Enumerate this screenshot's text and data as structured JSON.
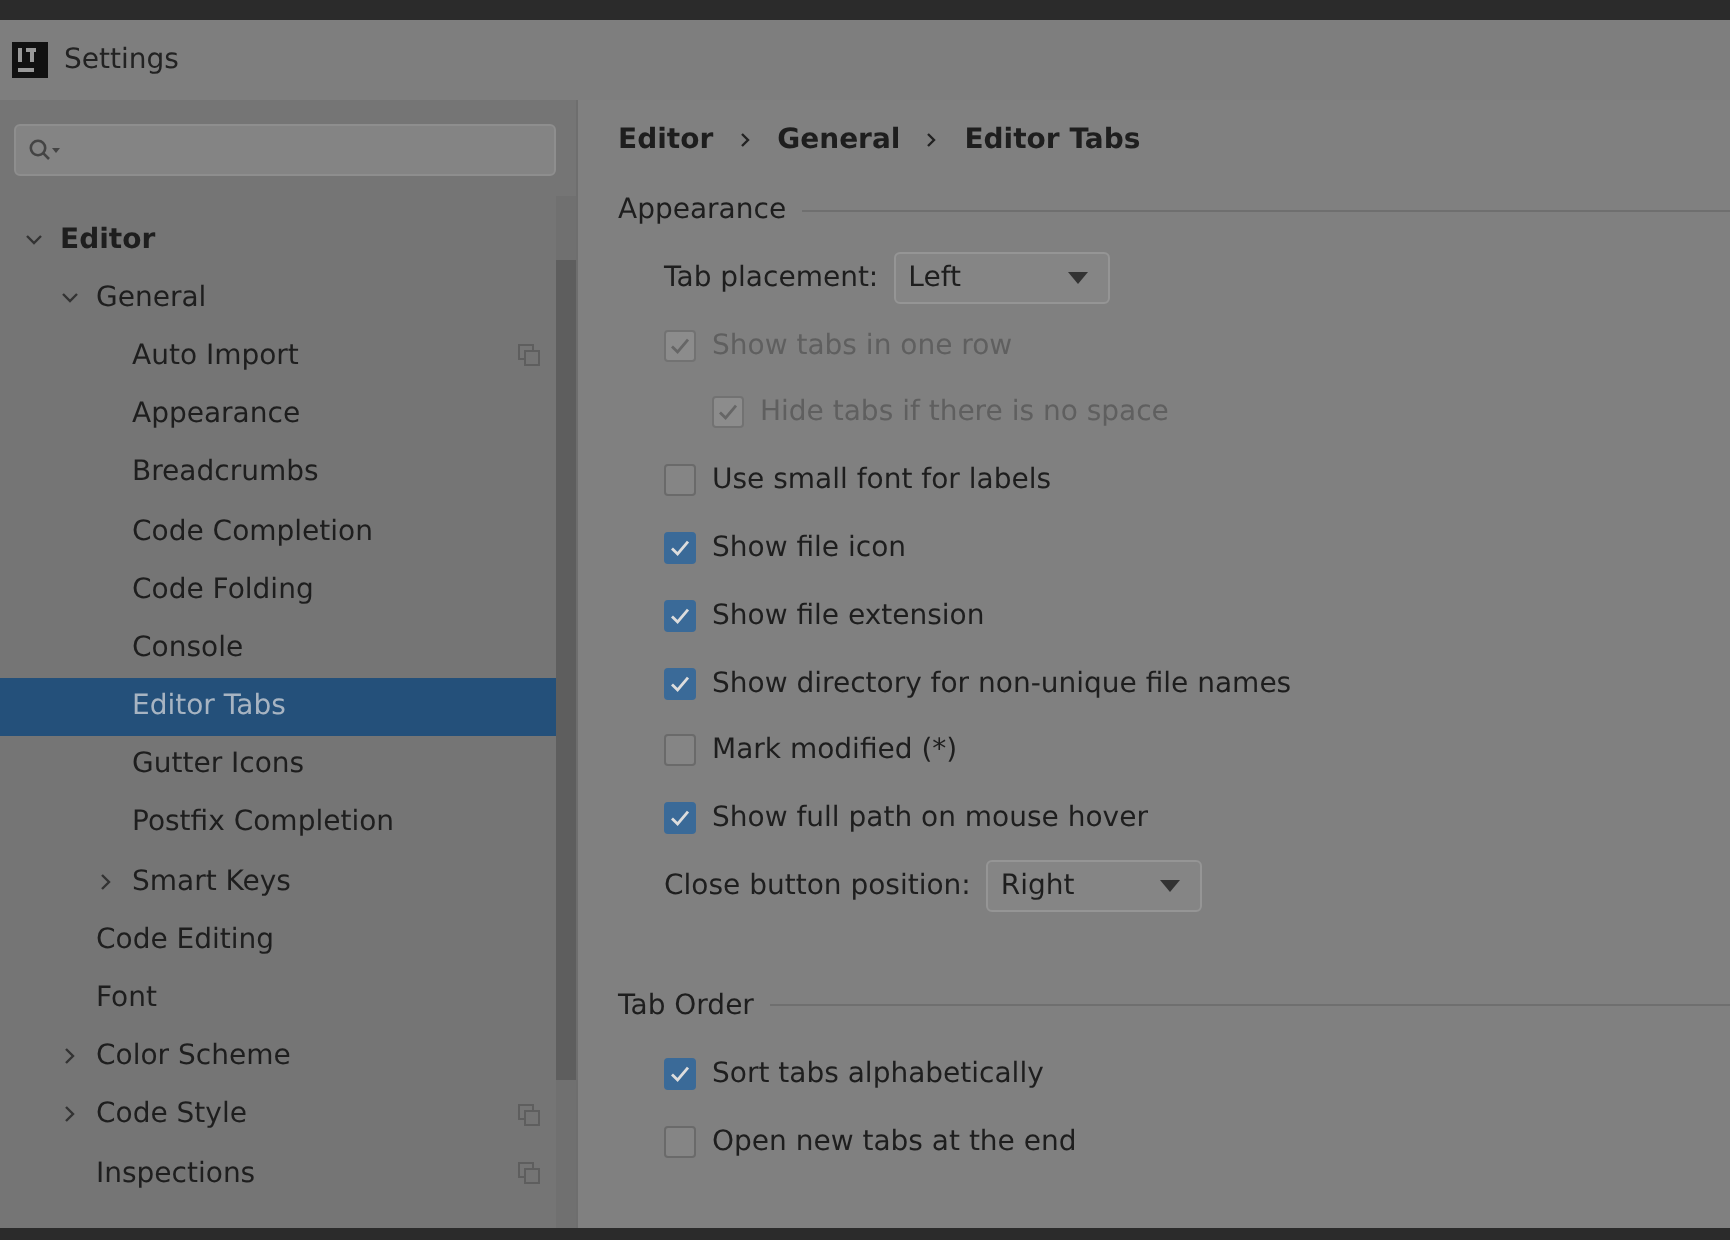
{
  "window": {
    "title": "Settings"
  },
  "sidebar": {
    "tree": [
      {
        "label": "Editor",
        "expanded": true,
        "selected": false,
        "project_scope": false,
        "children": [
          {
            "label": "General",
            "expanded": true,
            "selected": false,
            "project_scope": false,
            "children": [
              {
                "label": "Auto Import",
                "selected": false,
                "project_scope": true
              },
              {
                "label": "Appearance",
                "selected": false,
                "project_scope": false
              },
              {
                "label": "Breadcrumbs",
                "selected": false,
                "project_scope": false
              },
              {
                "label": "Code Completion",
                "selected": false,
                "project_scope": false
              },
              {
                "label": "Code Folding",
                "selected": false,
                "project_scope": false
              },
              {
                "label": "Console",
                "selected": false,
                "project_scope": false
              },
              {
                "label": "Editor Tabs",
                "selected": true,
                "project_scope": false
              },
              {
                "label": "Gutter Icons",
                "selected": false,
                "project_scope": false
              },
              {
                "label": "Postfix Completion",
                "selected": false,
                "project_scope": false
              },
              {
                "label": "Smart Keys",
                "expanded": false,
                "selected": false,
                "project_scope": false
              }
            ]
          },
          {
            "label": "Code Editing",
            "selected": false,
            "project_scope": false
          },
          {
            "label": "Font",
            "selected": false,
            "project_scope": false
          },
          {
            "label": "Color Scheme",
            "expanded": false,
            "selected": false,
            "project_scope": false
          },
          {
            "label": "Code Style",
            "expanded": false,
            "selected": false,
            "project_scope": true
          },
          {
            "label": "Inspections",
            "selected": false,
            "project_scope": true
          }
        ]
      }
    ]
  },
  "breadcrumb": [
    "Editor",
    "General",
    "Editor Tabs"
  ],
  "sections": [
    {
      "title": "Appearance",
      "options": [
        {
          "kind": "dropdown",
          "label": "Tab placement:",
          "value": "Left"
        },
        {
          "kind": "checkbox",
          "label": "Show tabs in one row",
          "checked": true,
          "disabled": true,
          "children": [
            {
              "kind": "checkbox",
              "label": "Hide tabs if there is no space",
              "checked": true,
              "disabled": true
            }
          ]
        },
        {
          "kind": "checkbox",
          "label": "Use small font for labels",
          "checked": false,
          "disabled": false
        },
        {
          "kind": "checkbox",
          "label": "Show file icon",
          "checked": true,
          "disabled": false
        },
        {
          "kind": "checkbox",
          "label": "Show file extension",
          "checked": true,
          "disabled": false
        },
        {
          "kind": "checkbox",
          "label": "Show directory for non-unique file names",
          "checked": true,
          "disabled": false
        },
        {
          "kind": "checkbox",
          "label": "Mark modified (*)",
          "checked": false,
          "disabled": false
        },
        {
          "kind": "checkbox",
          "label": "Show full path on mouse hover",
          "checked": true,
          "disabled": false
        },
        {
          "kind": "dropdown",
          "label": "Close button position:",
          "value": "Right"
        }
      ]
    },
    {
      "title": "Tab Order",
      "options": [
        {
          "kind": "checkbox",
          "label": "Sort tabs alphabetically",
          "checked": true,
          "disabled": false
        },
        {
          "kind": "checkbox",
          "label": "Open new tabs at the end",
          "checked": false,
          "disabled": false
        }
      ]
    }
  ]
}
